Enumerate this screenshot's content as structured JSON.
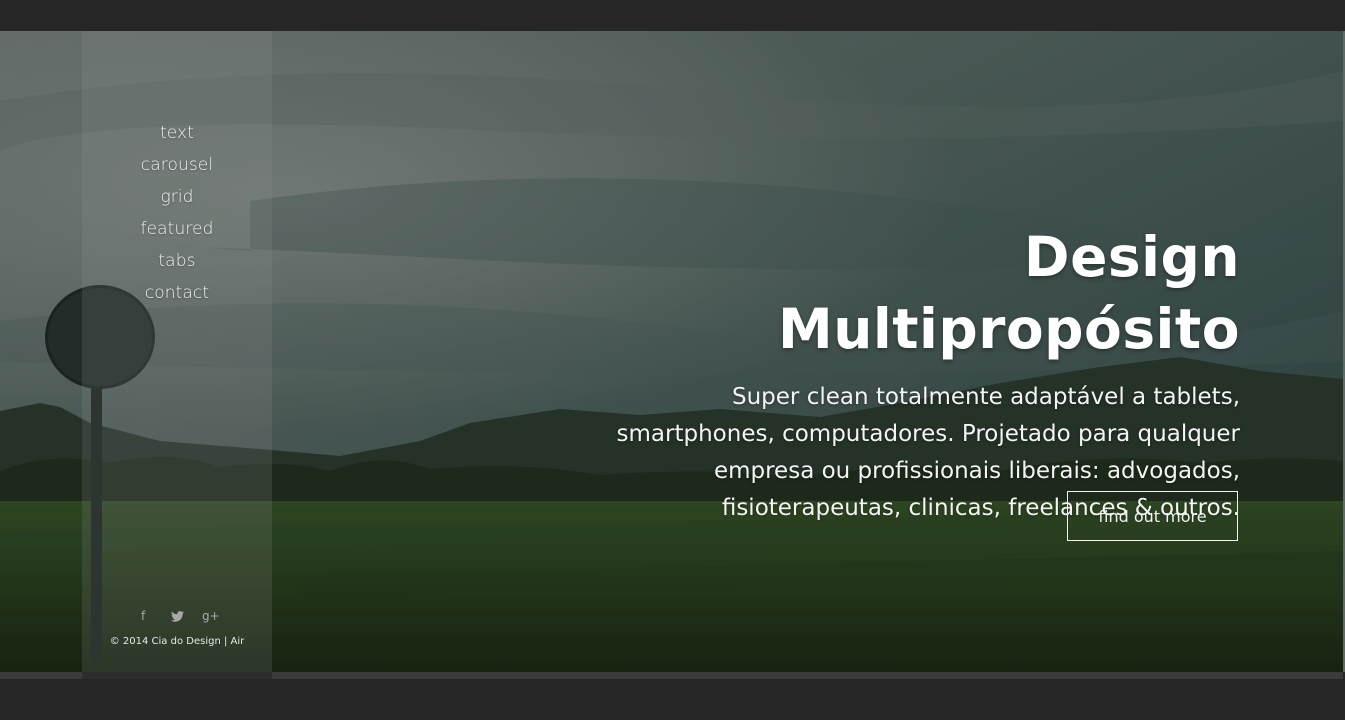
{
  "nav": {
    "items": [
      {
        "label": "text"
      },
      {
        "label": "carousel"
      },
      {
        "label": "grid"
      },
      {
        "label": "featured"
      },
      {
        "label": "tabs"
      },
      {
        "label": "contact"
      }
    ]
  },
  "social": {
    "icons": [
      "facebook-icon",
      "twitter-icon",
      "google-plus-icon"
    ],
    "facebook_glyph": "f",
    "twitter_glyph": "🐦",
    "googleplus_glyph": "g+"
  },
  "footer": {
    "copyright": "© 2014 Cia do Design | Air"
  },
  "hero": {
    "title": "Design Multipropósito",
    "line1": "Super clean totalmente adaptável a tablets,",
    "line2": "smartphones, computadores. Projetado para qualquer",
    "line3": "empresa ou profissionais liberais: advogados,",
    "line4": "fisioterapeutas, clinicas, freelances & outros.",
    "cta_label": "find out more"
  },
  "colors": {
    "page_background": "#262626",
    "text": "#ffffff"
  }
}
